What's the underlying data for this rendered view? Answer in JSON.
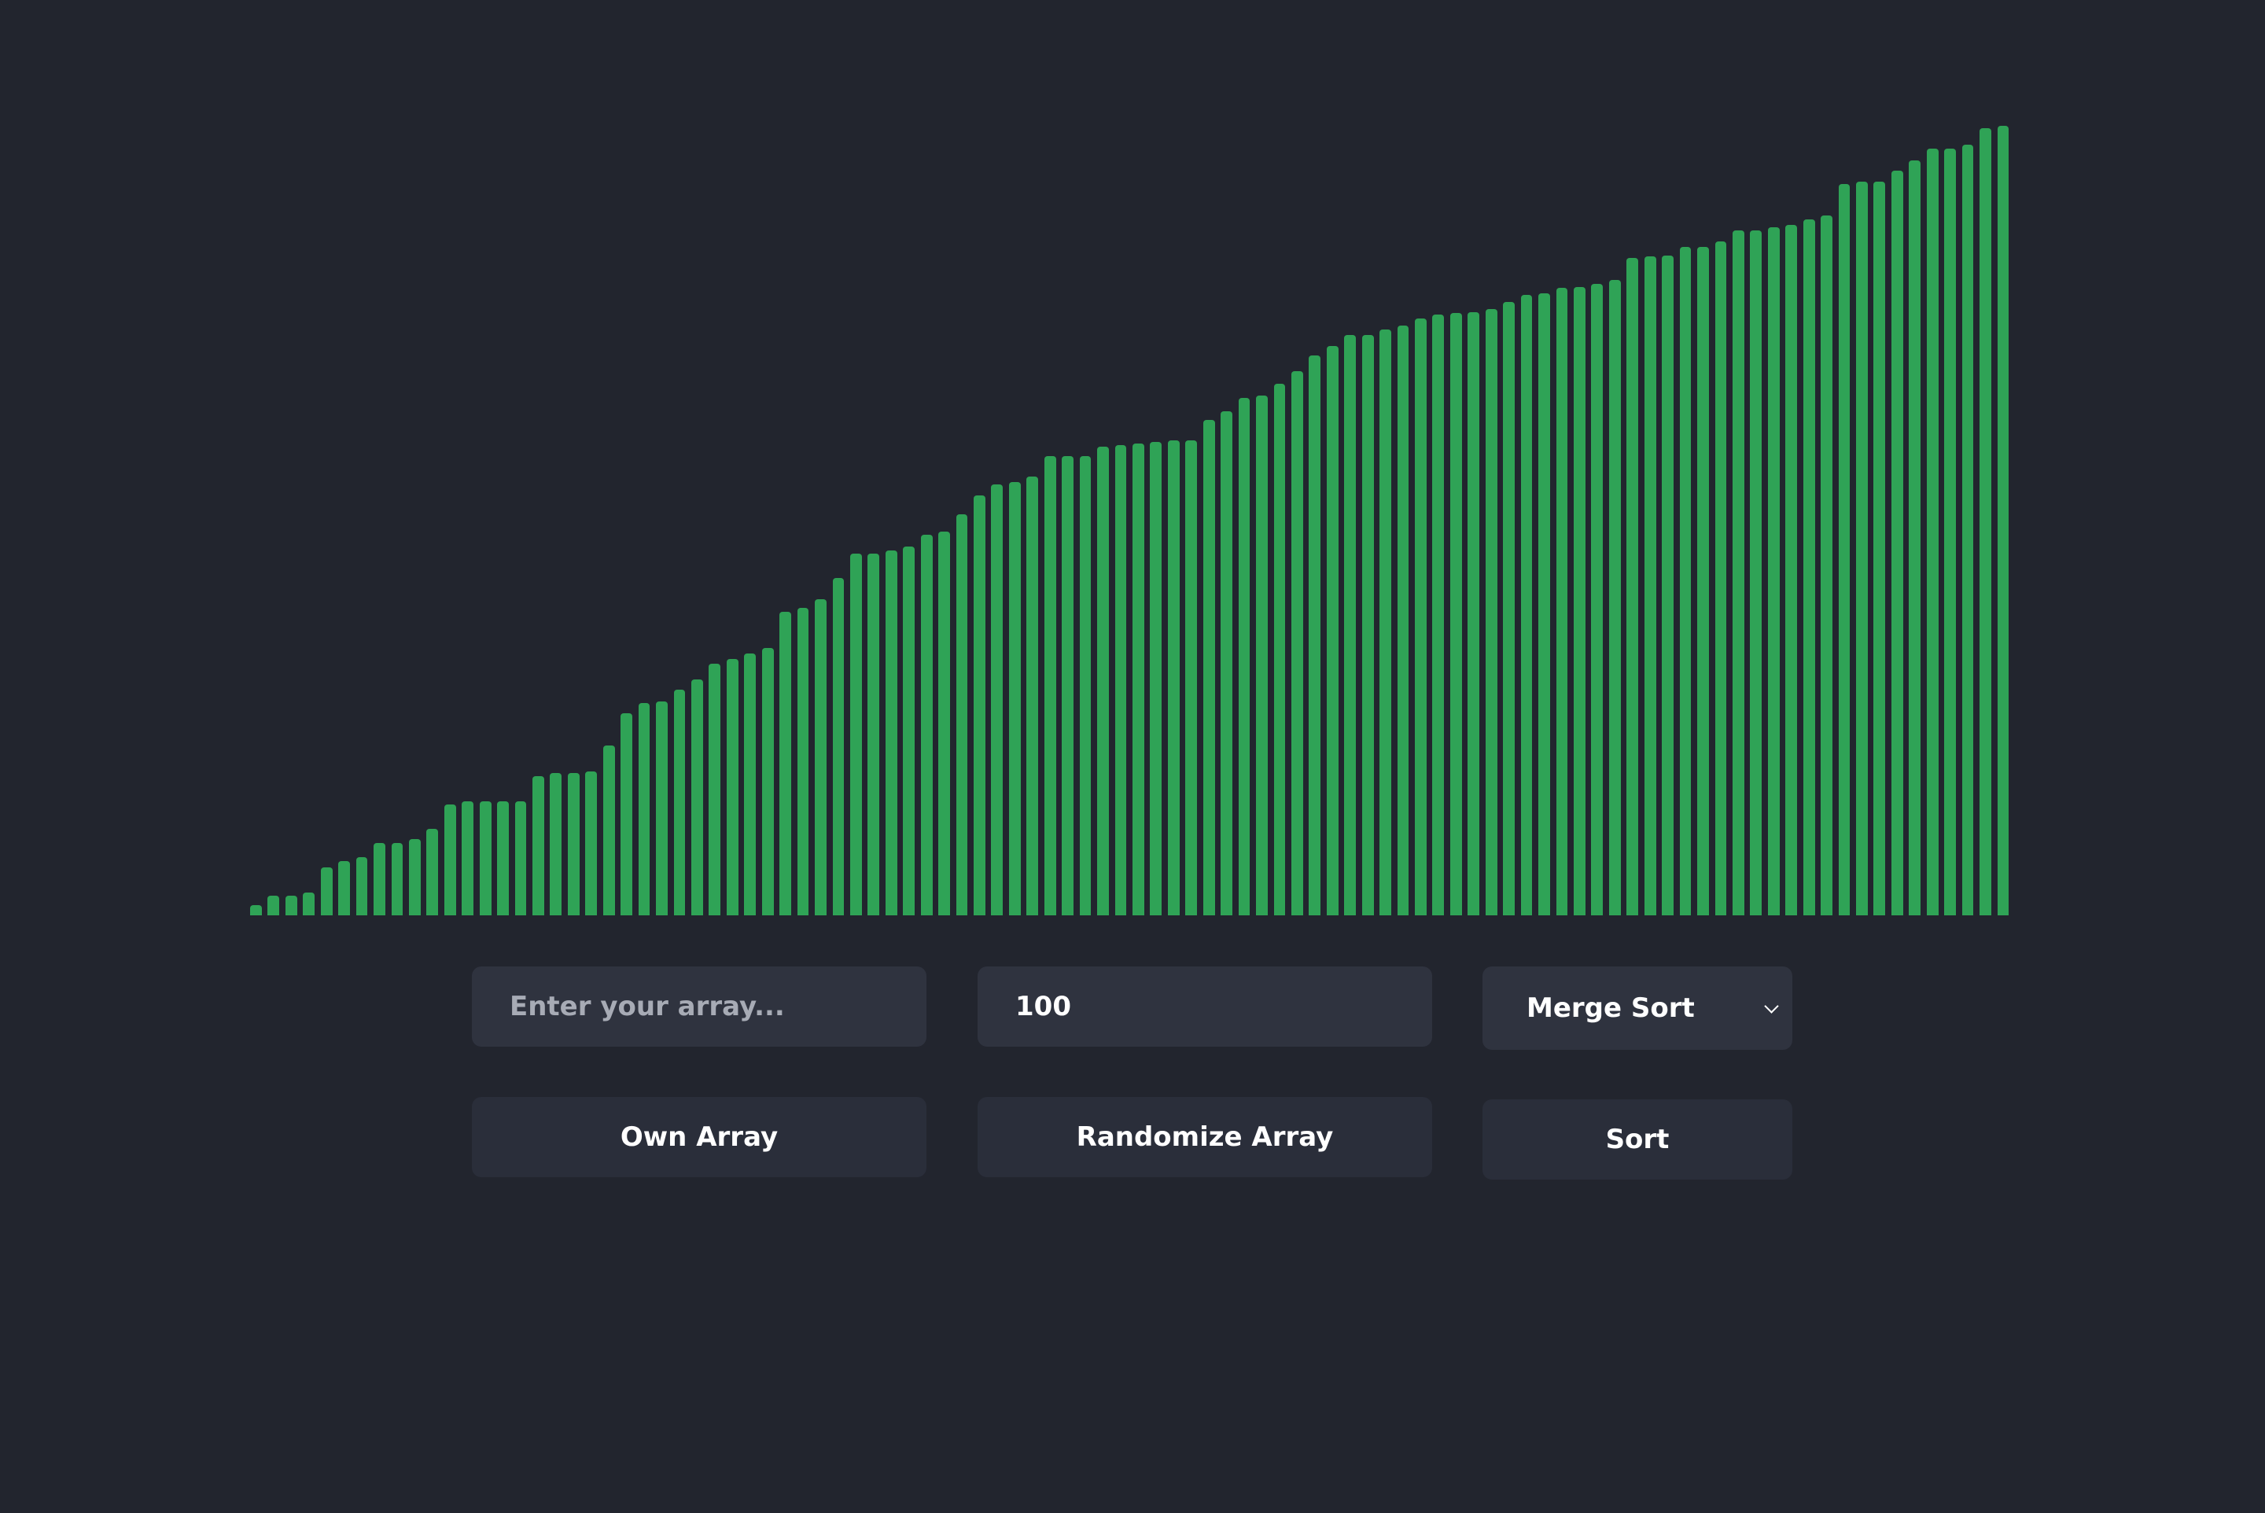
{
  "colors": {
    "background": "#22252e",
    "bar": "#2fa356",
    "control": "#2f333f",
    "button": "#2a2e3a",
    "text": "#ffffff",
    "placeholder": "#a7abb5"
  },
  "array_input": {
    "value": "",
    "placeholder": "Enter your array..."
  },
  "size_input": {
    "value": "100"
  },
  "algorithm_select": {
    "selected": "Merge Sort"
  },
  "buttons": {
    "own_array": "Own Array",
    "randomize_array": "Randomize Array",
    "sort": "Sort"
  },
  "chart_data": {
    "type": "bar",
    "sorted": true,
    "values": [
      12,
      24,
      24,
      28,
      58,
      66,
      70,
      87,
      87,
      92,
      105,
      134,
      138,
      138,
      138,
      138,
      168,
      172,
      172,
      174,
      205,
      244,
      257,
      258,
      273,
      285,
      304,
      310,
      316,
      323,
      367,
      372,
      382,
      408,
      437,
      437,
      441,
      446,
      460,
      464,
      485,
      507,
      521,
      524,
      530,
      555,
      555,
      555,
      566,
      568,
      570,
      572,
      574,
      574,
      599,
      609,
      625,
      628,
      642,
      658,
      677,
      688,
      701,
      701,
      708,
      713,
      721,
      726,
      728,
      729,
      733,
      741,
      750,
      752,
      758,
      759,
      763,
      768,
      794,
      796,
      797,
      808,
      808,
      814,
      828,
      828,
      831,
      834,
      841,
      846,
      884,
      887,
      887,
      900,
      912,
      926,
      926,
      931,
      951,
      954
    ]
  }
}
